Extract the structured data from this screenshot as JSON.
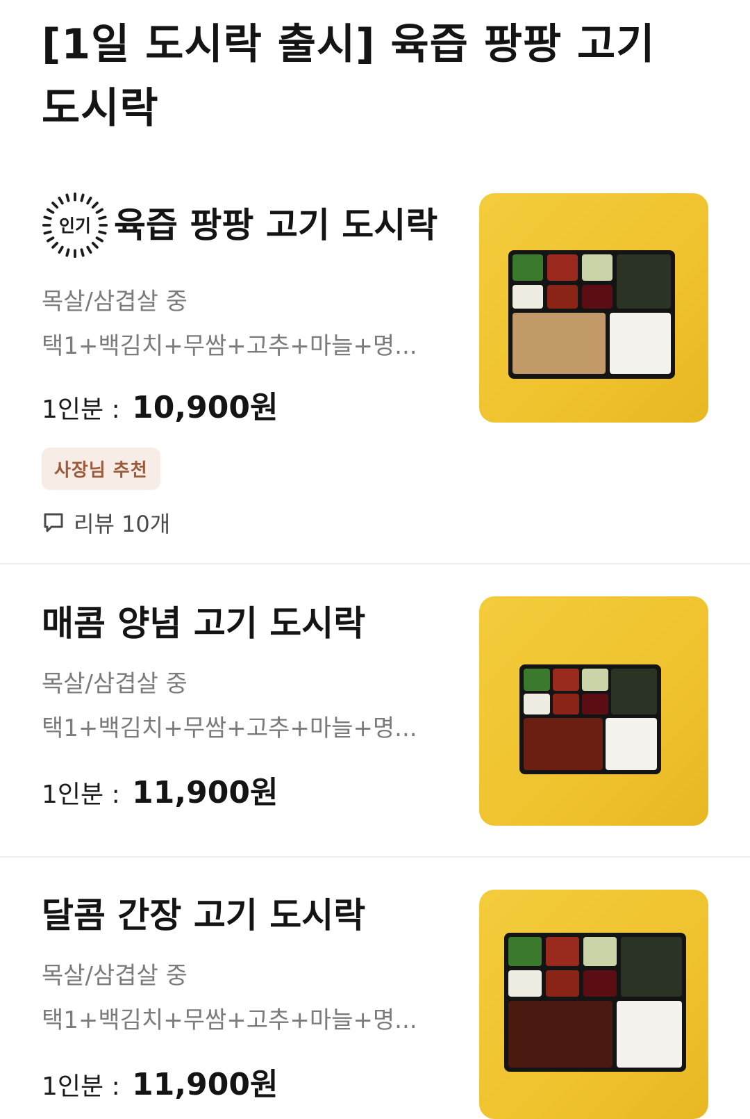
{
  "section": {
    "title": "[1일 도시락 출시] 육즙 팡팡 고기 도시락"
  },
  "items": [
    {
      "name": "육즙 팡팡 고기 도시락",
      "badge": "인기",
      "desc_line1": "목살/삼겹살 중",
      "desc_line2": "택1+백김치+무쌈+고추+마늘+명...",
      "price_label": "1인분 :",
      "price": "10,900원",
      "tag": "사장님 추천",
      "review": "리뷰 10개"
    },
    {
      "name": "매콤 양념 고기 도시락",
      "desc_line1": "목살/삼겹살 중",
      "desc_line2": "택1+백김치+무쌈+고추+마늘+명...",
      "price_label": "1인분 :",
      "price": "11,900원"
    },
    {
      "name": "달콤 간장 고기 도시락",
      "desc_line1": "목살/삼겹살 중",
      "desc_line2": "택1+백김치+무쌈+고추+마늘+명...",
      "price_label": "1인분 :",
      "price": "11,900원"
    }
  ],
  "colors": {
    "thumb_bg": "#f0c22e",
    "tag_bg": "#f7ede6",
    "tag_text": "#9b5a3a",
    "desc_text": "#7b7b7b"
  },
  "icons": {
    "popular": "sunburst-badge-icon",
    "review": "speech-bubble-icon"
  }
}
